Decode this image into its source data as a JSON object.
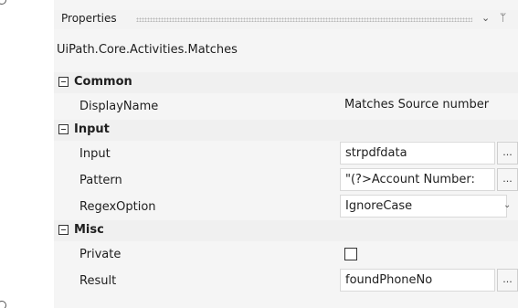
{
  "panel": {
    "title": "Properties",
    "chevron_icon": "chevron-down-icon",
    "pin_icon": "pin-icon",
    "activity_type": "UiPath.Core.Activities.Matches"
  },
  "categories": {
    "common": {
      "name": "Common",
      "display_name": {
        "label": "DisplayName",
        "value": "Matches Source number"
      }
    },
    "input": {
      "name": "Input",
      "input": {
        "label": "Input",
        "value": "strpdfdata",
        "button": "..."
      },
      "pattern": {
        "label": "Pattern",
        "value": "\"(?>Account Number:",
        "button": "..."
      },
      "regex_option": {
        "label": "RegexOption",
        "value": "IgnoreCase"
      }
    },
    "misc": {
      "name": "Misc",
      "private": {
        "label": "Private",
        "checked": false
      },
      "result": {
        "label": "Result",
        "value": "foundPhoneNo",
        "button": "..."
      }
    }
  }
}
